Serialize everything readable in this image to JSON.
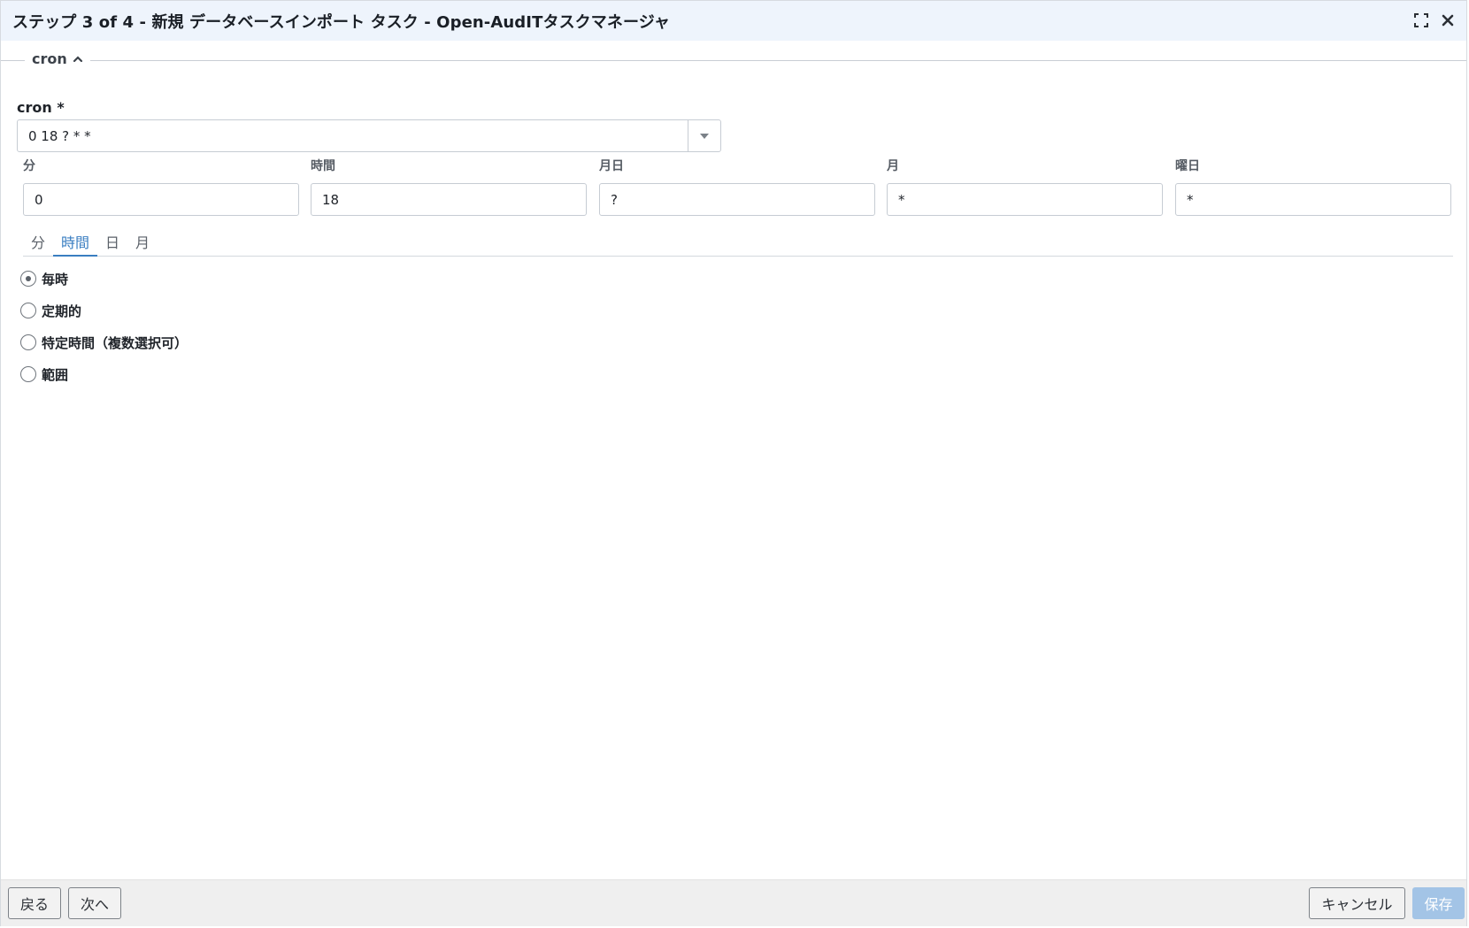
{
  "window": {
    "title": "ステップ 3 of 4 - 新規 データベースインポート タスク - Open-AudITタスクマネージャ",
    "icons": [
      "fullscreen-icon",
      "close-icon"
    ]
  },
  "fieldset": {
    "legend": "cron"
  },
  "cron": {
    "label": "cron *",
    "value": "0 18 ? * *"
  },
  "fields": [
    {
      "label": "分",
      "value": "0"
    },
    {
      "label": "時間",
      "value": "18"
    },
    {
      "label": "月日",
      "value": "?"
    },
    {
      "label": "月",
      "value": "*"
    },
    {
      "label": "曜日",
      "value": "*"
    }
  ],
  "tabs": [
    {
      "label": "分",
      "active": false
    },
    {
      "label": "時間",
      "active": true
    },
    {
      "label": "日",
      "active": false
    },
    {
      "label": "月",
      "active": false
    }
  ],
  "radios": [
    {
      "label": "毎時",
      "checked": true
    },
    {
      "label": "定期的",
      "checked": false
    },
    {
      "label": "特定時間（複数選択可）",
      "checked": false
    },
    {
      "label": "範囲",
      "checked": false
    }
  ],
  "footer": {
    "back_label": "戻る",
    "next_label": "次へ",
    "cancel_label": "キャンセル",
    "save_label": "保存"
  },
  "colors": {
    "titlebar_bg": "#eef4fc",
    "accent": "#3a7ec1",
    "save_disabled": "#a3c4e6"
  }
}
